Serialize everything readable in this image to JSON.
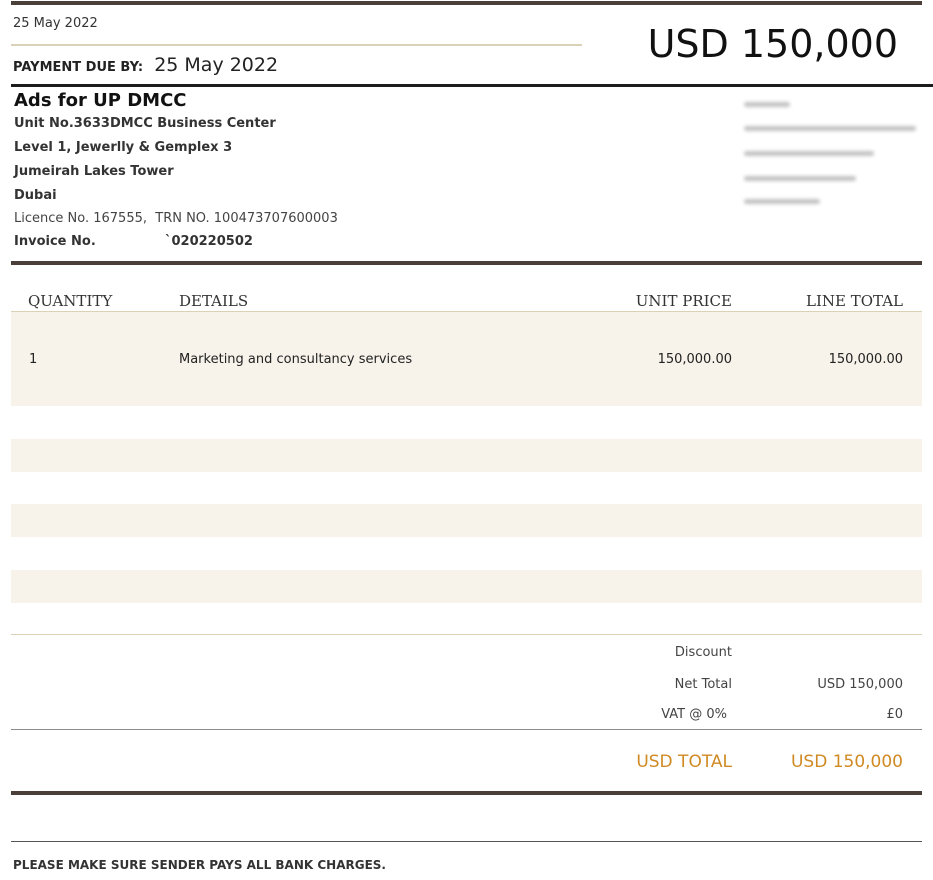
{
  "header": {
    "date": "25 May 2022",
    "payment_due_label": "PAYMENT DUE BY:",
    "payment_due_date": "25 May 2022",
    "amount_due": "USD 150,000"
  },
  "sender": {
    "name": "Ads for UP DMCC",
    "address_lines": [
      "Unit No.3633DMCC Business Center",
      "Level 1, Jewerlly & Gemplex 3",
      "Jumeirah Lakes Tower",
      "Dubai"
    ],
    "licence_line": "Licence No. 167555,  TRN NO. 100473707600003",
    "invoice_label": "Invoice No.",
    "invoice_number": "`020220502"
  },
  "recipient": {
    "redacted": true
  },
  "table": {
    "headers": {
      "quantity": "QUANTITY",
      "details": "DETAILS",
      "unit_price": "UNIT PRICE",
      "line_total": "LINE TOTAL"
    },
    "rows": [
      {
        "quantity": "1",
        "details": "Marketing and consultancy services",
        "unit_price": "150,000.00",
        "line_total": "150,000.00"
      }
    ]
  },
  "summary": {
    "discount_label": "Discount",
    "discount_value": "",
    "net_total_label": "Net Total",
    "net_total_value": "USD 150,000",
    "vat_label": "VAT @ 0%",
    "vat_value": "£0",
    "total_label": "USD TOTAL",
    "total_value": "USD 150,000"
  },
  "footer": {
    "note": "PLEASE MAKE SURE SENDER PAYS ALL BANK CHARGES."
  },
  "colors": {
    "rule_dark": "#4a3f39",
    "band": "#f7f3ea",
    "accent_gold": "#d08a23"
  }
}
